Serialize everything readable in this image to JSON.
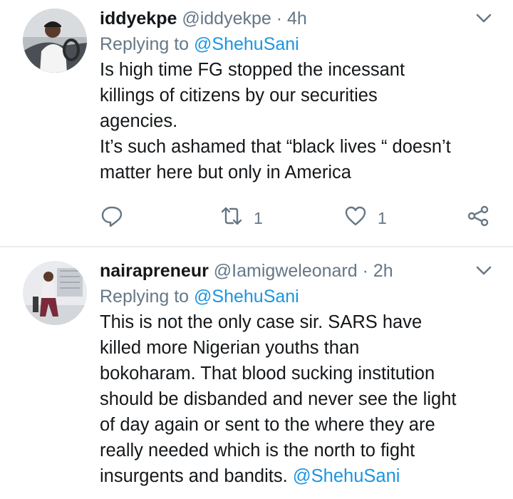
{
  "tweets": [
    {
      "name": "iddyekpe",
      "handle": "@iddyekpe",
      "separator": "·",
      "time": "4h",
      "replying_prefix": "Replying to ",
      "replying_to": "@ShehuSani",
      "lines": [
        "Is high time FG stopped the incessant",
        "killings of citizens by our securities",
        "agencies.",
        "It’s such ashamed that “black lives “ doesn’t",
        "matter here but only in America"
      ],
      "retweets": "1",
      "likes": "1"
    },
    {
      "name": "nairapreneur",
      "handle": "@Iamigweleonard",
      "separator": "·",
      "time": "2h",
      "replying_prefix": "Replying to ",
      "replying_to": "@ShehuSani",
      "lines": [
        "This is not the only case sir. SARS have",
        "killed more Nigerian youths than",
        "bokoharam. That blood sucking institution",
        "should be disbanded and never see the light",
        "of day again or sent to the where they are",
        "really needed which is the north to fight",
        "insurgents and bandits. "
      ],
      "trailing_mention": "@ShehuSani"
    }
  ],
  "colors": {
    "link": "#1b95e0",
    "muted": "#657786",
    "text": "#14171a",
    "divider": "#e6ecf0"
  },
  "icons": [
    "chevron-down-icon",
    "reply-icon",
    "retweet-icon",
    "like-icon",
    "share-icon"
  ]
}
